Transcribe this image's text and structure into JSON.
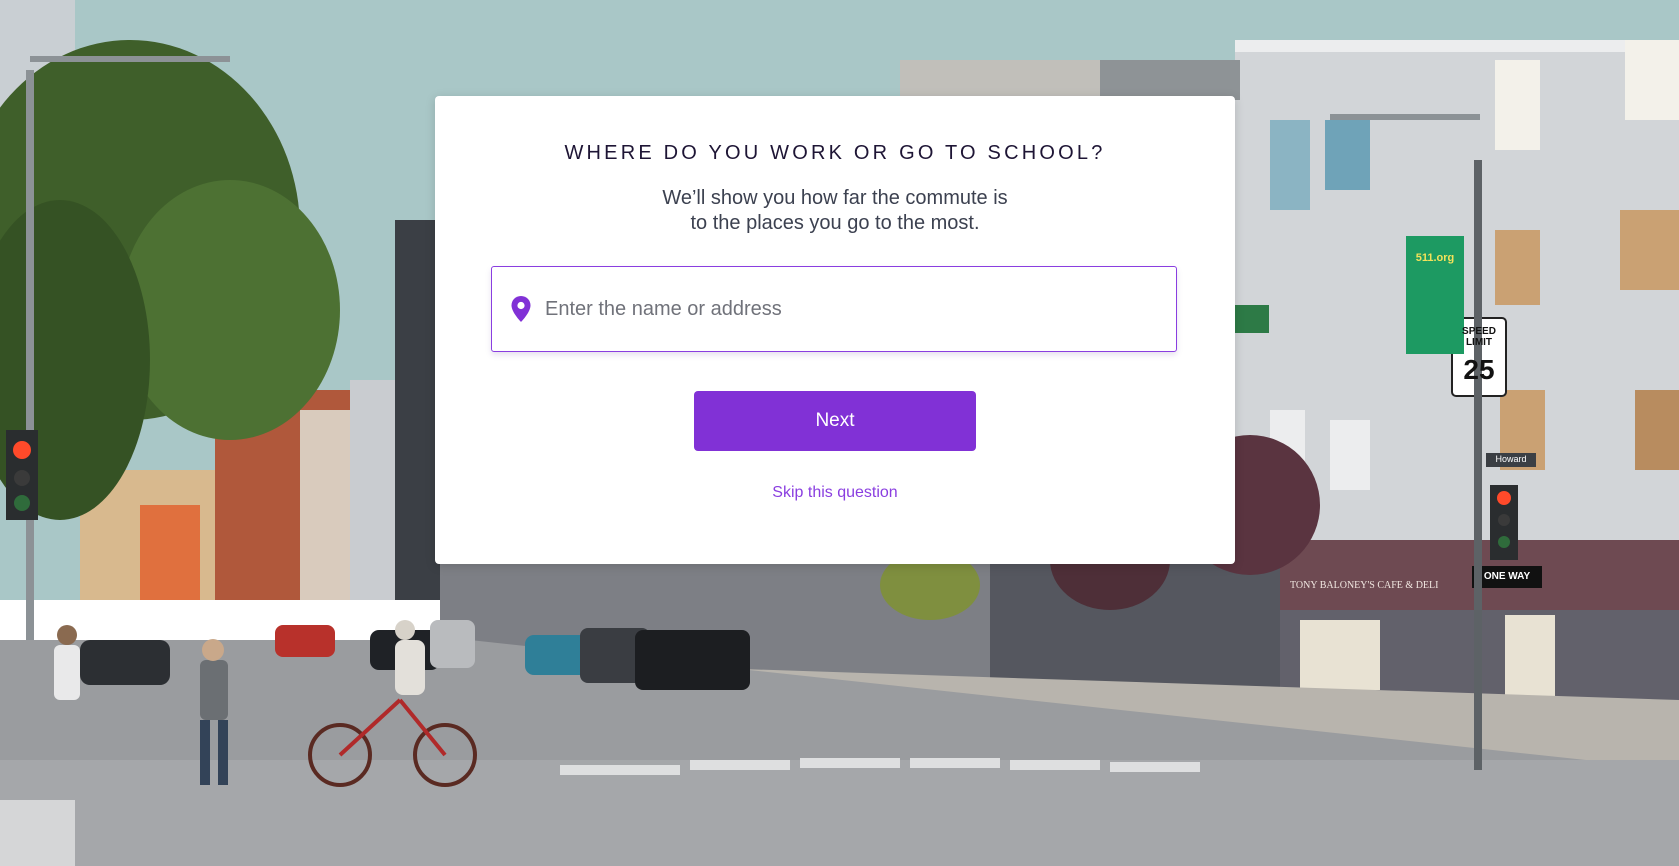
{
  "background": {
    "sign_speed_limit": "SPEED LIMIT",
    "sign_speed_value": "25",
    "sign_one_way": "ONE WAY",
    "sign_street": "Howard",
    "banner_511": "511.org",
    "store_awning": "TONY BALONEY'S CAFE & DELI"
  },
  "modal": {
    "title": "WHERE DO YOU WORK OR GO TO SCHOOL?",
    "subtitle_line1": "We’ll show you how far the commute is",
    "subtitle_line2": "to the places you go to the most.",
    "search": {
      "placeholder": "Enter the name or address",
      "value": ""
    },
    "next_label": "Next",
    "skip_label": "Skip this question",
    "accent_color": "#8131d6",
    "icon": "map-pin-icon"
  }
}
